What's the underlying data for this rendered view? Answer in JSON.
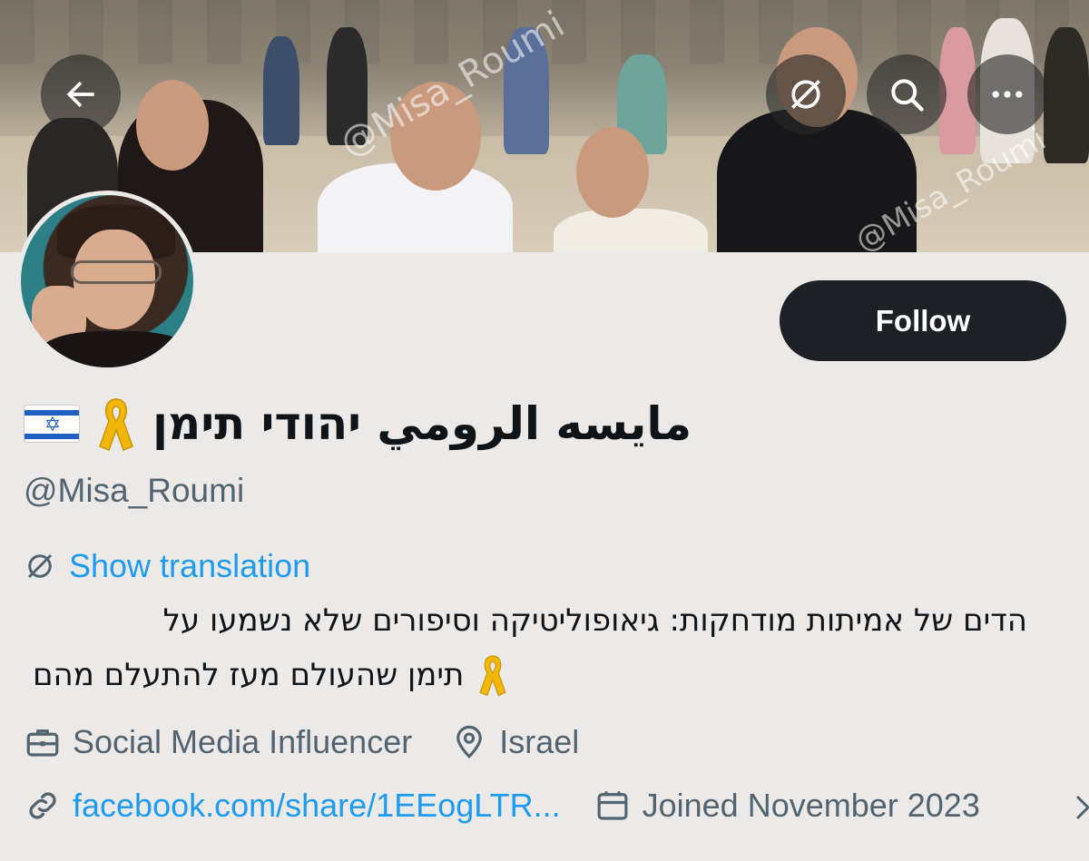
{
  "header": {
    "back_icon": "arrow-left-icon",
    "translate_icon": "translate-globe-icon",
    "search_icon": "search-icon",
    "more_icon": "more-horizontal-icon",
    "watermark": "@Misa_Roumi"
  },
  "profile": {
    "display_name": "مايسه الرومي יהודי תימן",
    "handle": "@Misa_Roumi",
    "follow_label": "Follow",
    "show_translation_label": "Show translation",
    "bio_line_1": "הדים של אמיתות מודחקות: גיאופוליטיקה וסיפורים שלא נשמעו על",
    "bio_line_2": "תימן שהעולם מעז להתעלם מהם",
    "profession": "Social Media Influencer",
    "location": "Israel",
    "website": "facebook.com/share/1EEogLTR...",
    "joined": "Joined November 2023"
  },
  "colors": {
    "accent": "#1d9bf0",
    "follow_bg": "#1d2125",
    "secondary_text": "#536471",
    "ribbon": "#f2b705"
  }
}
